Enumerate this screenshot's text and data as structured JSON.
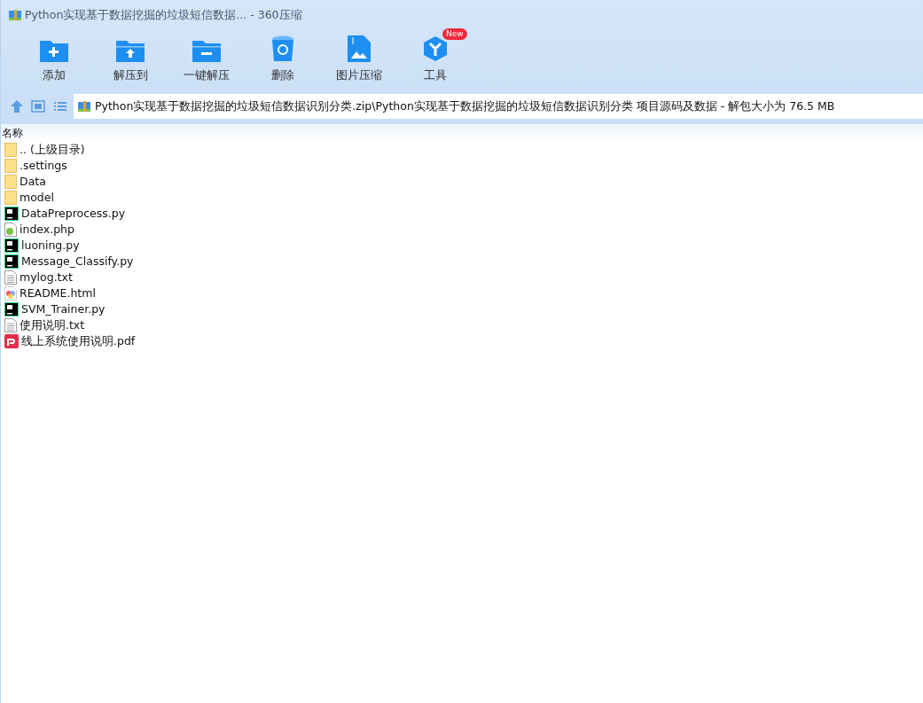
{
  "window": {
    "title": "Python实现基于数据挖掘的垃圾短信数据... - 360压缩"
  },
  "toolbar": [
    {
      "label": "添加",
      "kind": "add"
    },
    {
      "label": "解压到",
      "kind": "extract"
    },
    {
      "label": "一键解压",
      "kind": "oneclick"
    },
    {
      "label": "删除",
      "kind": "delete"
    },
    {
      "label": "图片压缩",
      "kind": "image"
    },
    {
      "label": "工具",
      "kind": "tools",
      "badge": "New"
    }
  ],
  "address_bar": {
    "path": "Python实现基于数据挖掘的垃圾短信数据识别分类.zip\\Python实现基于数据挖掘的垃圾短信数据识别分类 项目源码及数据 - 解包大小为 76.5 MB"
  },
  "file_list": {
    "columns": [
      "名称"
    ],
    "rows": [
      {
        "name": ".. (上级目录)",
        "kind": "folder"
      },
      {
        "name": ".settings",
        "kind": "folder"
      },
      {
        "name": "Data",
        "kind": "folder"
      },
      {
        "name": "model",
        "kind": "folder"
      },
      {
        "name": "DataPreprocess.py",
        "kind": "python"
      },
      {
        "name": "index.php",
        "kind": "php"
      },
      {
        "name": "luoning.py",
        "kind": "python"
      },
      {
        "name": "Message_Classify.py",
        "kind": "python"
      },
      {
        "name": "mylog.txt",
        "kind": "text"
      },
      {
        "name": "README.html",
        "kind": "html"
      },
      {
        "name": "SVM_Trainer.py",
        "kind": "python"
      },
      {
        "name": "使用说明.txt",
        "kind": "text"
      },
      {
        "name": "线上系统使用说明.pdf",
        "kind": "pdf"
      }
    ]
  }
}
